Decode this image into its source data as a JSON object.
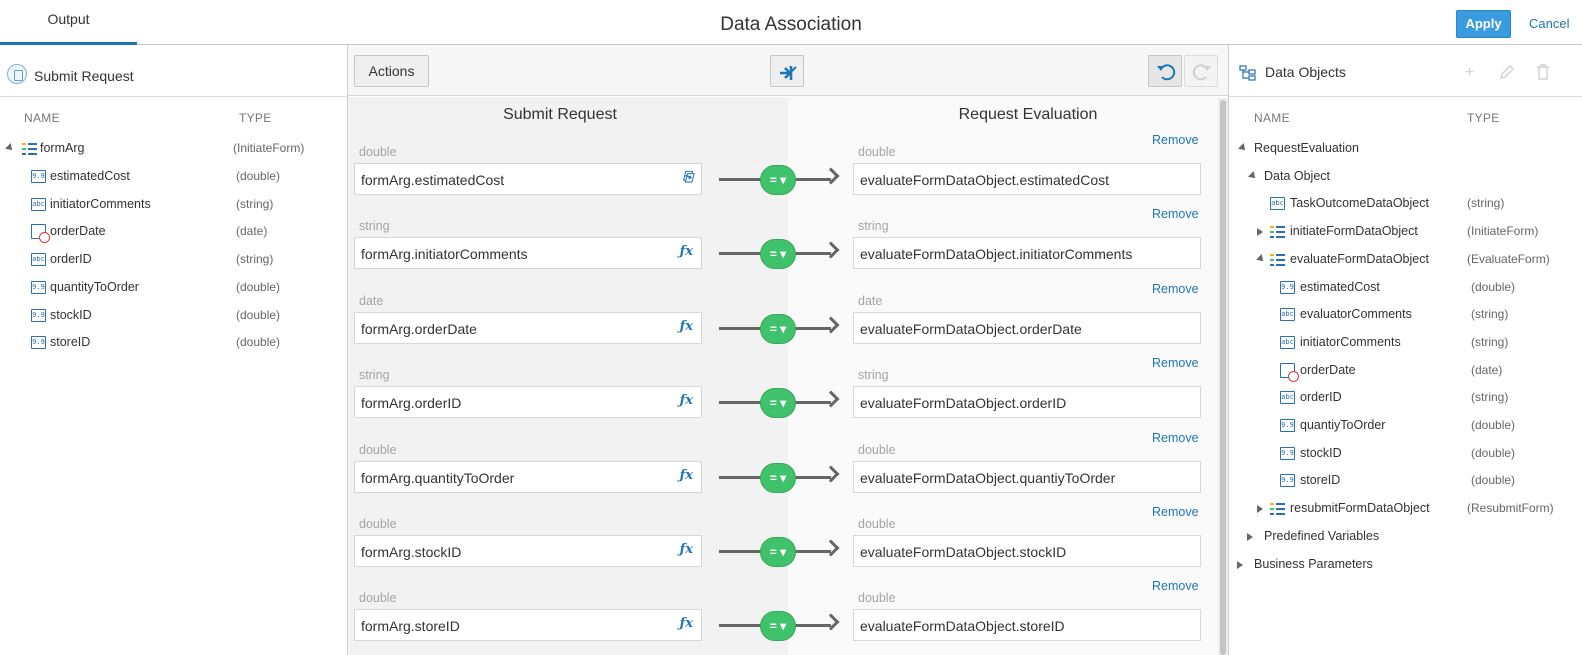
{
  "header": {
    "tab_output": "Output",
    "title": "Data Association",
    "apply_label": "Apply",
    "cancel_label": "Cancel"
  },
  "left": {
    "title": "Submit Request",
    "col_name": "NAME",
    "col_type": "TYPE",
    "root": {
      "label": "formArg",
      "type": "(InitiateForm)"
    },
    "items": [
      {
        "label": "estimatedCost",
        "type": "(double)",
        "icon": "number-icon"
      },
      {
        "label": "initiatorComments",
        "type": "(string)",
        "icon": "string-icon"
      },
      {
        "label": "orderDate",
        "type": "(date)",
        "icon": "date-icon"
      },
      {
        "label": "orderID",
        "type": "(string)",
        "icon": "string-icon"
      },
      {
        "label": "quantityToOrder",
        "type": "(double)",
        "icon": "number-icon"
      },
      {
        "label": "stockID",
        "type": "(double)",
        "icon": "number-icon"
      },
      {
        "label": "storeID",
        "type": "(double)",
        "icon": "number-icon"
      }
    ]
  },
  "toolbar": {
    "actions_label": "Actions"
  },
  "mapping": {
    "source_title": "Submit Request",
    "target_title": "Request Evaluation",
    "remove_label": "Remove",
    "operator": "=",
    "rows": [
      {
        "source_type": "double",
        "source": "formArg.estimatedCost",
        "target_type": "double",
        "target": "evaluateFormDataObject.estimatedCost"
      },
      {
        "source_type": "string",
        "source": "formArg.initiatorComments",
        "target_type": "string",
        "target": "evaluateFormDataObject.initiatorComments"
      },
      {
        "source_type": "date",
        "source": "formArg.orderDate",
        "target_type": "date",
        "target": "evaluateFormDataObject.orderDate"
      },
      {
        "source_type": "string",
        "source": "formArg.orderID",
        "target_type": "string",
        "target": "evaluateFormDataObject.orderID"
      },
      {
        "source_type": "double",
        "source": "formArg.quantityToOrder",
        "target_type": "double",
        "target": "evaluateFormDataObject.quantiyToOrder"
      },
      {
        "source_type": "double",
        "source": "formArg.stockID",
        "target_type": "double",
        "target": "evaluateFormDataObject.stockID"
      },
      {
        "source_type": "double",
        "source": "formArg.storeID",
        "target_type": "double",
        "target": "evaluateFormDataObject.storeID"
      }
    ]
  },
  "right": {
    "title": "Data Objects",
    "col_name": "NAME",
    "col_type": "TYPE",
    "tree": [
      {
        "label": "RequestEvaluation",
        "type": ""
      },
      {
        "label": "Data Object",
        "type": ""
      },
      {
        "label": "TaskOutcomeDataObject",
        "type": "(string)"
      },
      {
        "label": "initiateFormDataObject",
        "type": "(InitiateForm)"
      },
      {
        "label": "evaluateFormDataObject",
        "type": "(EvaluateForm)"
      },
      {
        "label": "estimatedCost",
        "type": "(double)"
      },
      {
        "label": "evaluatorComments",
        "type": "(string)"
      },
      {
        "label": "initiatorComments",
        "type": "(string)"
      },
      {
        "label": "orderDate",
        "type": "(date)"
      },
      {
        "label": "orderID",
        "type": "(string)"
      },
      {
        "label": "quantiyToOrder",
        "type": "(double)"
      },
      {
        "label": "stockID",
        "type": "(double)"
      },
      {
        "label": "storeID",
        "type": "(double)"
      },
      {
        "label": "resubmitFormDataObject",
        "type": "(ResubmitForm)"
      },
      {
        "label": "Predefined Variables",
        "type": ""
      },
      {
        "label": "Business Parameters",
        "type": ""
      }
    ]
  },
  "colors": {
    "accent": "#1f76b7",
    "apply": "#3a9be0",
    "operator_pill": "#3fc26b"
  }
}
